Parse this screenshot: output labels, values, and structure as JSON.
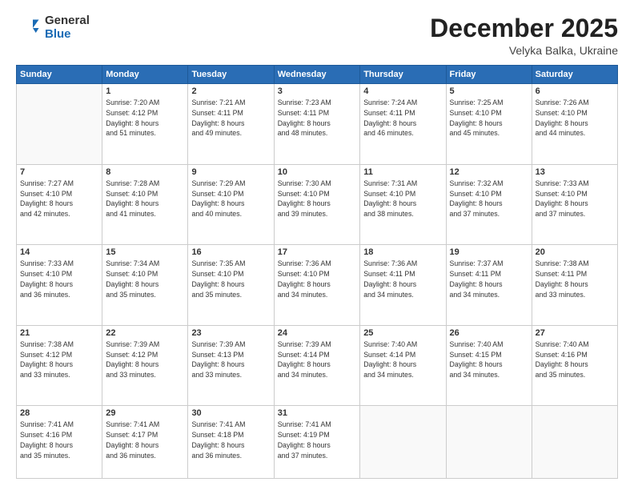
{
  "header": {
    "logo_general": "General",
    "logo_blue": "Blue",
    "month_title": "December 2025",
    "subtitle": "Velyka Balka, Ukraine"
  },
  "weekdays": [
    "Sunday",
    "Monday",
    "Tuesday",
    "Wednesday",
    "Thursday",
    "Friday",
    "Saturday"
  ],
  "weeks": [
    [
      {
        "day": "",
        "info": ""
      },
      {
        "day": "1",
        "info": "Sunrise: 7:20 AM\nSunset: 4:12 PM\nDaylight: 8 hours\nand 51 minutes."
      },
      {
        "day": "2",
        "info": "Sunrise: 7:21 AM\nSunset: 4:11 PM\nDaylight: 8 hours\nand 49 minutes."
      },
      {
        "day": "3",
        "info": "Sunrise: 7:23 AM\nSunset: 4:11 PM\nDaylight: 8 hours\nand 48 minutes."
      },
      {
        "day": "4",
        "info": "Sunrise: 7:24 AM\nSunset: 4:11 PM\nDaylight: 8 hours\nand 46 minutes."
      },
      {
        "day": "5",
        "info": "Sunrise: 7:25 AM\nSunset: 4:10 PM\nDaylight: 8 hours\nand 45 minutes."
      },
      {
        "day": "6",
        "info": "Sunrise: 7:26 AM\nSunset: 4:10 PM\nDaylight: 8 hours\nand 44 minutes."
      }
    ],
    [
      {
        "day": "7",
        "info": "Sunrise: 7:27 AM\nSunset: 4:10 PM\nDaylight: 8 hours\nand 42 minutes."
      },
      {
        "day": "8",
        "info": "Sunrise: 7:28 AM\nSunset: 4:10 PM\nDaylight: 8 hours\nand 41 minutes."
      },
      {
        "day": "9",
        "info": "Sunrise: 7:29 AM\nSunset: 4:10 PM\nDaylight: 8 hours\nand 40 minutes."
      },
      {
        "day": "10",
        "info": "Sunrise: 7:30 AM\nSunset: 4:10 PM\nDaylight: 8 hours\nand 39 minutes."
      },
      {
        "day": "11",
        "info": "Sunrise: 7:31 AM\nSunset: 4:10 PM\nDaylight: 8 hours\nand 38 minutes."
      },
      {
        "day": "12",
        "info": "Sunrise: 7:32 AM\nSunset: 4:10 PM\nDaylight: 8 hours\nand 37 minutes."
      },
      {
        "day": "13",
        "info": "Sunrise: 7:33 AM\nSunset: 4:10 PM\nDaylight: 8 hours\nand 37 minutes."
      }
    ],
    [
      {
        "day": "14",
        "info": "Sunrise: 7:33 AM\nSunset: 4:10 PM\nDaylight: 8 hours\nand 36 minutes."
      },
      {
        "day": "15",
        "info": "Sunrise: 7:34 AM\nSunset: 4:10 PM\nDaylight: 8 hours\nand 35 minutes."
      },
      {
        "day": "16",
        "info": "Sunrise: 7:35 AM\nSunset: 4:10 PM\nDaylight: 8 hours\nand 35 minutes."
      },
      {
        "day": "17",
        "info": "Sunrise: 7:36 AM\nSunset: 4:10 PM\nDaylight: 8 hours\nand 34 minutes."
      },
      {
        "day": "18",
        "info": "Sunrise: 7:36 AM\nSunset: 4:11 PM\nDaylight: 8 hours\nand 34 minutes."
      },
      {
        "day": "19",
        "info": "Sunrise: 7:37 AM\nSunset: 4:11 PM\nDaylight: 8 hours\nand 34 minutes."
      },
      {
        "day": "20",
        "info": "Sunrise: 7:38 AM\nSunset: 4:11 PM\nDaylight: 8 hours\nand 33 minutes."
      }
    ],
    [
      {
        "day": "21",
        "info": "Sunrise: 7:38 AM\nSunset: 4:12 PM\nDaylight: 8 hours\nand 33 minutes."
      },
      {
        "day": "22",
        "info": "Sunrise: 7:39 AM\nSunset: 4:12 PM\nDaylight: 8 hours\nand 33 minutes."
      },
      {
        "day": "23",
        "info": "Sunrise: 7:39 AM\nSunset: 4:13 PM\nDaylight: 8 hours\nand 33 minutes."
      },
      {
        "day": "24",
        "info": "Sunrise: 7:39 AM\nSunset: 4:14 PM\nDaylight: 8 hours\nand 34 minutes."
      },
      {
        "day": "25",
        "info": "Sunrise: 7:40 AM\nSunset: 4:14 PM\nDaylight: 8 hours\nand 34 minutes."
      },
      {
        "day": "26",
        "info": "Sunrise: 7:40 AM\nSunset: 4:15 PM\nDaylight: 8 hours\nand 34 minutes."
      },
      {
        "day": "27",
        "info": "Sunrise: 7:40 AM\nSunset: 4:16 PM\nDaylight: 8 hours\nand 35 minutes."
      }
    ],
    [
      {
        "day": "28",
        "info": "Sunrise: 7:41 AM\nSunset: 4:16 PM\nDaylight: 8 hours\nand 35 minutes."
      },
      {
        "day": "29",
        "info": "Sunrise: 7:41 AM\nSunset: 4:17 PM\nDaylight: 8 hours\nand 36 minutes."
      },
      {
        "day": "30",
        "info": "Sunrise: 7:41 AM\nSunset: 4:18 PM\nDaylight: 8 hours\nand 36 minutes."
      },
      {
        "day": "31",
        "info": "Sunrise: 7:41 AM\nSunset: 4:19 PM\nDaylight: 8 hours\nand 37 minutes."
      },
      {
        "day": "",
        "info": ""
      },
      {
        "day": "",
        "info": ""
      },
      {
        "day": "",
        "info": ""
      }
    ]
  ]
}
